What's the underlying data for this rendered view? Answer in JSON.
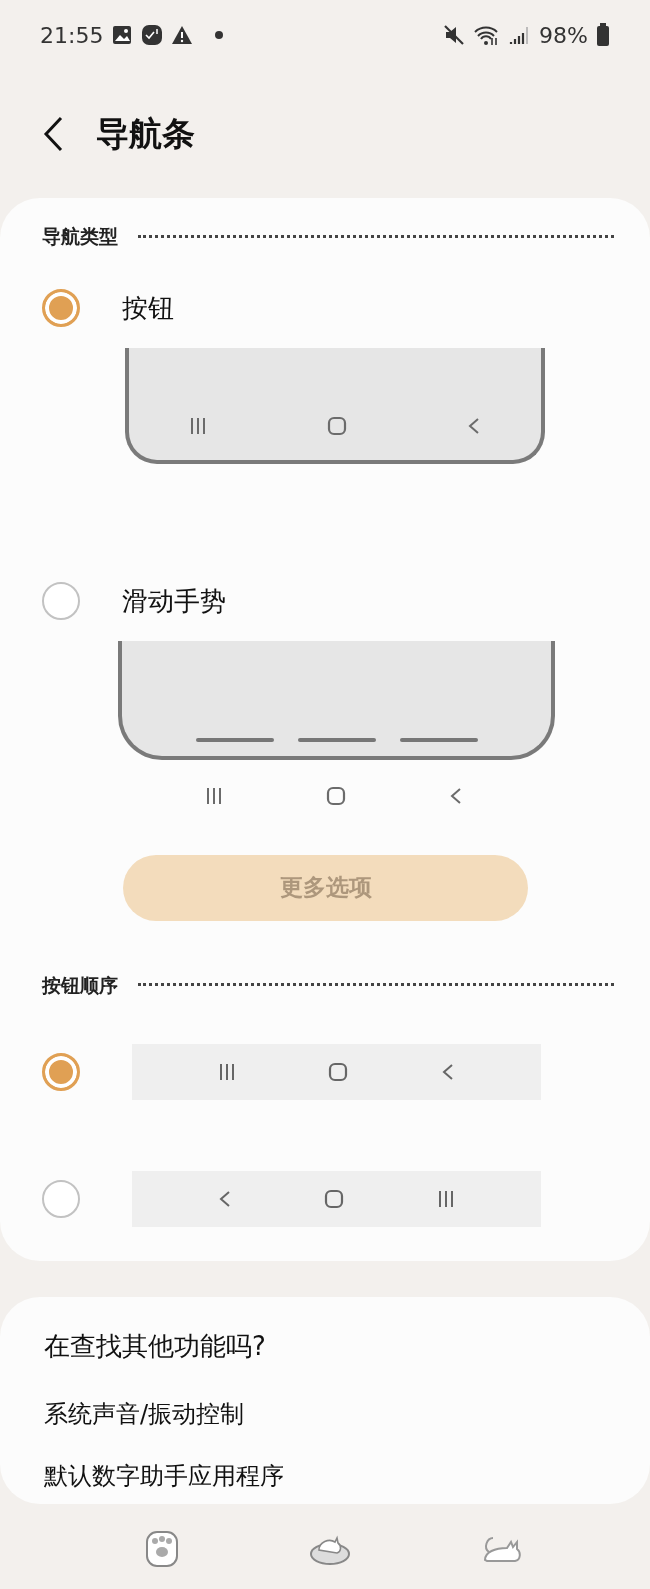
{
  "status_bar": {
    "time": "21:55",
    "battery": "98%"
  },
  "header": {
    "title": "导航条"
  },
  "nav_type": {
    "heading": "导航类型",
    "options": [
      {
        "label": "按钮",
        "selected": true,
        "kind": "buttons"
      },
      {
        "label": "滑动手势",
        "selected": false,
        "kind": "gestures"
      }
    ],
    "more_button": "更多选项"
  },
  "button_order": {
    "heading": "按钮顺序",
    "options": [
      {
        "selected": true,
        "keys": [
          {
            "kind": "recents"
          },
          {
            "kind": "home"
          },
          {
            "kind": "back"
          }
        ]
      },
      {
        "selected": false,
        "keys": [
          {
            "kind": "back"
          },
          {
            "kind": "home"
          },
          {
            "kind": "recents"
          }
        ]
      }
    ]
  },
  "suggestions": {
    "title": "在查找其他功能吗?",
    "links": [
      "系统声音/振动控制",
      "默认数字助手应用程序"
    ]
  }
}
